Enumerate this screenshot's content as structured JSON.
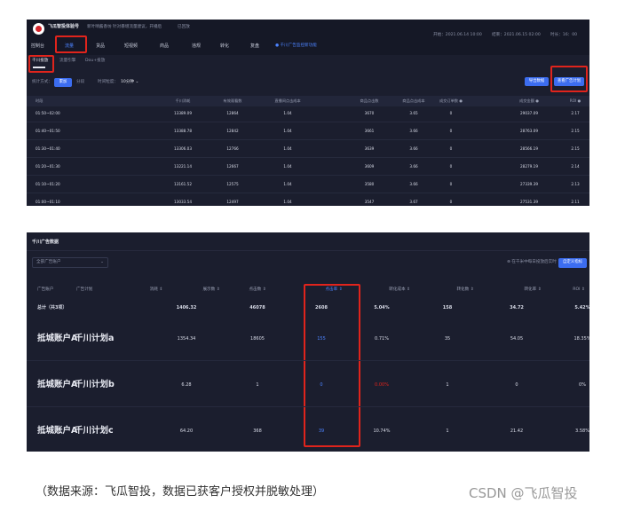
{
  "panel1": {
    "brand": {
      "title": "飞瓜智投体验号",
      "subtitle": "新叶晴酱香坊 针对暴增流量建议，开播后",
      "live_label": "已回放"
    },
    "time_range": {
      "start": "开始：2021.06.14 10:00",
      "end": "结束：2021.06.15 02:00",
      "duration": "时长：16：00"
    },
    "nav": [
      "控制台",
      "流量",
      "货品",
      "短视频",
      "商品",
      "违规",
      "转化",
      "复盘"
    ],
    "nav_active": "流量",
    "nav_tag": "● 千川广告监控新功能",
    "sub_tabs": [
      "千川投放",
      "流量引擎",
      "Dou+投放"
    ],
    "sub_tab_active": "千川投放",
    "filter": {
      "label": "统计方式：",
      "opt_active": "累加",
      "opt_other": "分段",
      "granularity_label": "时间粒度：",
      "granularity_value": "10分钟 ⌄"
    },
    "buttons": {
      "export": "导出数据",
      "plan": "查看广告计划"
    },
    "columns": [
      "时段",
      "千川消耗",
      "有效观看数",
      "直播间点击成本",
      "商品点击数",
      "商品点击成本",
      "成交订单数 ●",
      "成交金额 ●",
      "ROI ●"
    ],
    "rows": [
      [
        "01:50~02:00",
        "13389.09",
        "12864",
        "1.04",
        "3670",
        "3.65",
        "0",
        "29037.09",
        "2.17"
      ],
      [
        "01:40~01:50",
        "13388.78",
        "12842",
        "1.04",
        "3661",
        "3.66",
        "0",
        "28763.09",
        "2.15"
      ],
      [
        "01:30~01:40",
        "13306.03",
        "12766",
        "1.04",
        "3639",
        "3.66",
        "0",
        "28566.19",
        "2.15"
      ],
      [
        "01:20~01:30",
        "13221.14",
        "12667",
        "1.04",
        "3609",
        "3.66",
        "0",
        "28279.19",
        "2.14"
      ],
      [
        "01:10~01:20",
        "13161.52",
        "12575",
        "1.04",
        "3580",
        "3.66",
        "0",
        "27339.39",
        "2.13"
      ],
      [
        "01:00~01:10",
        "13033.54",
        "12497",
        "1.04",
        "3547",
        "3.67",
        "0",
        "27531.39",
        "2.11"
      ]
    ]
  },
  "panel2": {
    "title": "千川广告数据",
    "select_placeholder": "全部广告账户",
    "hint": "⊕ 在千米中每日投放后实时",
    "settings_button": "自定义指标",
    "columns": [
      "广告账户",
      "广告计划",
      "消耗 ⇕",
      "展示数 ⇕",
      "点击数 ⇕",
      "点击率 ⇕",
      "转化成本 ⇕",
      "转化数 ⇕",
      "转化率 ⇕",
      "ROI ⇕"
    ],
    "sorted_column": "点击率 ⇕",
    "summary": [
      "总计（共3项）",
      "",
      "1406.32",
      "46078",
      "2608",
      "5.04%",
      "158",
      "34.72",
      "5.42%"
    ],
    "rows": [
      {
        "account": "抵城账户A",
        "plan": "千川计划a",
        "values": [
          "1354.34",
          "18605",
          "155",
          "0.71%",
          "35",
          "54.05",
          "18.35%"
        ],
        "warn": false
      },
      {
        "account": "抵城账户A",
        "plan": "千川计划b",
        "values": "6.28|1|0|0.00%|1|0|0%",
        "warn": true
      },
      {
        "account": "抵城账户A",
        "plan": "千川计划c",
        "values": [
          "64.20",
          "368",
          "39",
          "10.74%",
          "1",
          "21.42",
          "3.58%"
        ],
        "warn": false
      }
    ],
    "accent_red": "#e0241c",
    "accent_blue": "#3c6df0"
  },
  "caption": "（数据来源：飞瓜智投，数据已获客户授权并脱敏处理）",
  "watermark": "CSDN @飞瓜智投"
}
